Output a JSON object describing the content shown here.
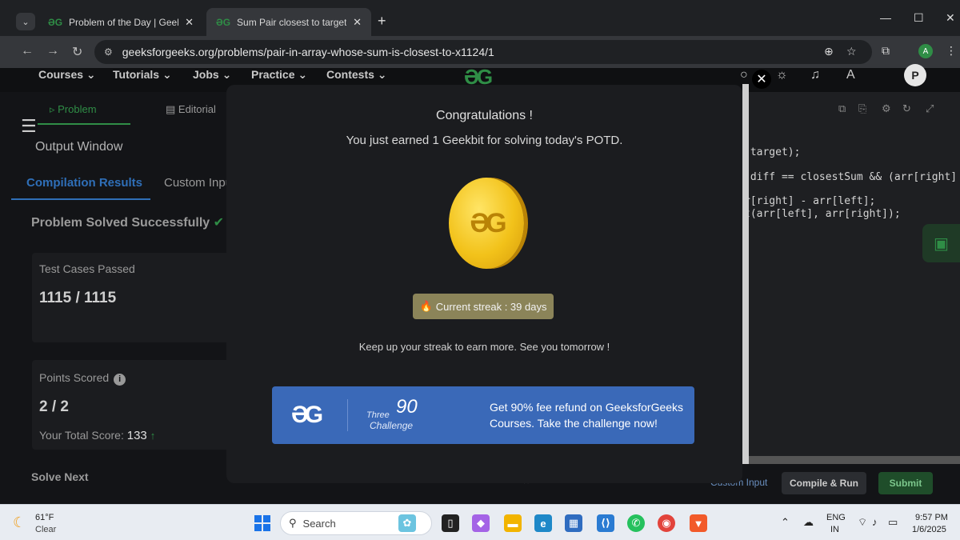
{
  "browser": {
    "tabs": [
      {
        "title": "Problem of the Day | GeeksforG",
        "favicon": "gfg-icon"
      },
      {
        "title": "Sum Pair closest to target | Prac",
        "favicon": "gfg-icon"
      }
    ],
    "url": "geeksforgeeks.org/problems/pair-in-array-whose-sum-is-closest-to-x1124/1",
    "profile_initial": "A"
  },
  "nav": {
    "items": [
      "Courses",
      "Tutorials",
      "Jobs",
      "Practice",
      "Contests"
    ],
    "user_initial": "P"
  },
  "problem_tabs": {
    "problem": "Problem",
    "editorial": "Editorial"
  },
  "output": {
    "window_title": "Output Window",
    "tab_results": "Compilation Results",
    "tab_custom": "Custom Inpu",
    "status": "Problem Solved Successfully",
    "tests_label": "Test Cases Passed",
    "tests_value": "1115 / 1115",
    "points_label": "Points Scored",
    "points_value": "2 / 2",
    "total_label": "Your Total Score:",
    "total_value": "133",
    "solve_next": "Solve Next"
  },
  "code": {
    "lines": [
      " target);",
      "(diff == closestSum && (arr[right]",
      "r[right] - arr[left];",
      "t(arr[left], arr[right]);"
    ]
  },
  "editor_bar": {
    "custom_input": "Custom Input",
    "compile": "Compile & Run",
    "submit": "Submit"
  },
  "modal": {
    "title": "Congratulations !",
    "subtitle": "You just earned 1 Geekbit for solving today's POTD.",
    "streak": "Current streak : 39 days",
    "keep": "Keep up your streak to earn more. See you tomorrow !",
    "banner": {
      "three": "Three",
      "ninety": "90",
      "challenge": "Challenge",
      "text": "Get 90% fee refund on GeeksforGeeks Courses. Take the challenge now!"
    }
  },
  "taskbar": {
    "temp": "61°F",
    "condition": "Clear",
    "search": "Search",
    "lang1": "ENG",
    "lang2": "IN",
    "time": "9:57 PM",
    "date": "1/6/2025"
  },
  "colors": {
    "gfg_green": "#2f8d46",
    "banner_blue": "#3a69b8",
    "streak_bg": "#8b8459",
    "link_blue": "#2f6fb8"
  }
}
